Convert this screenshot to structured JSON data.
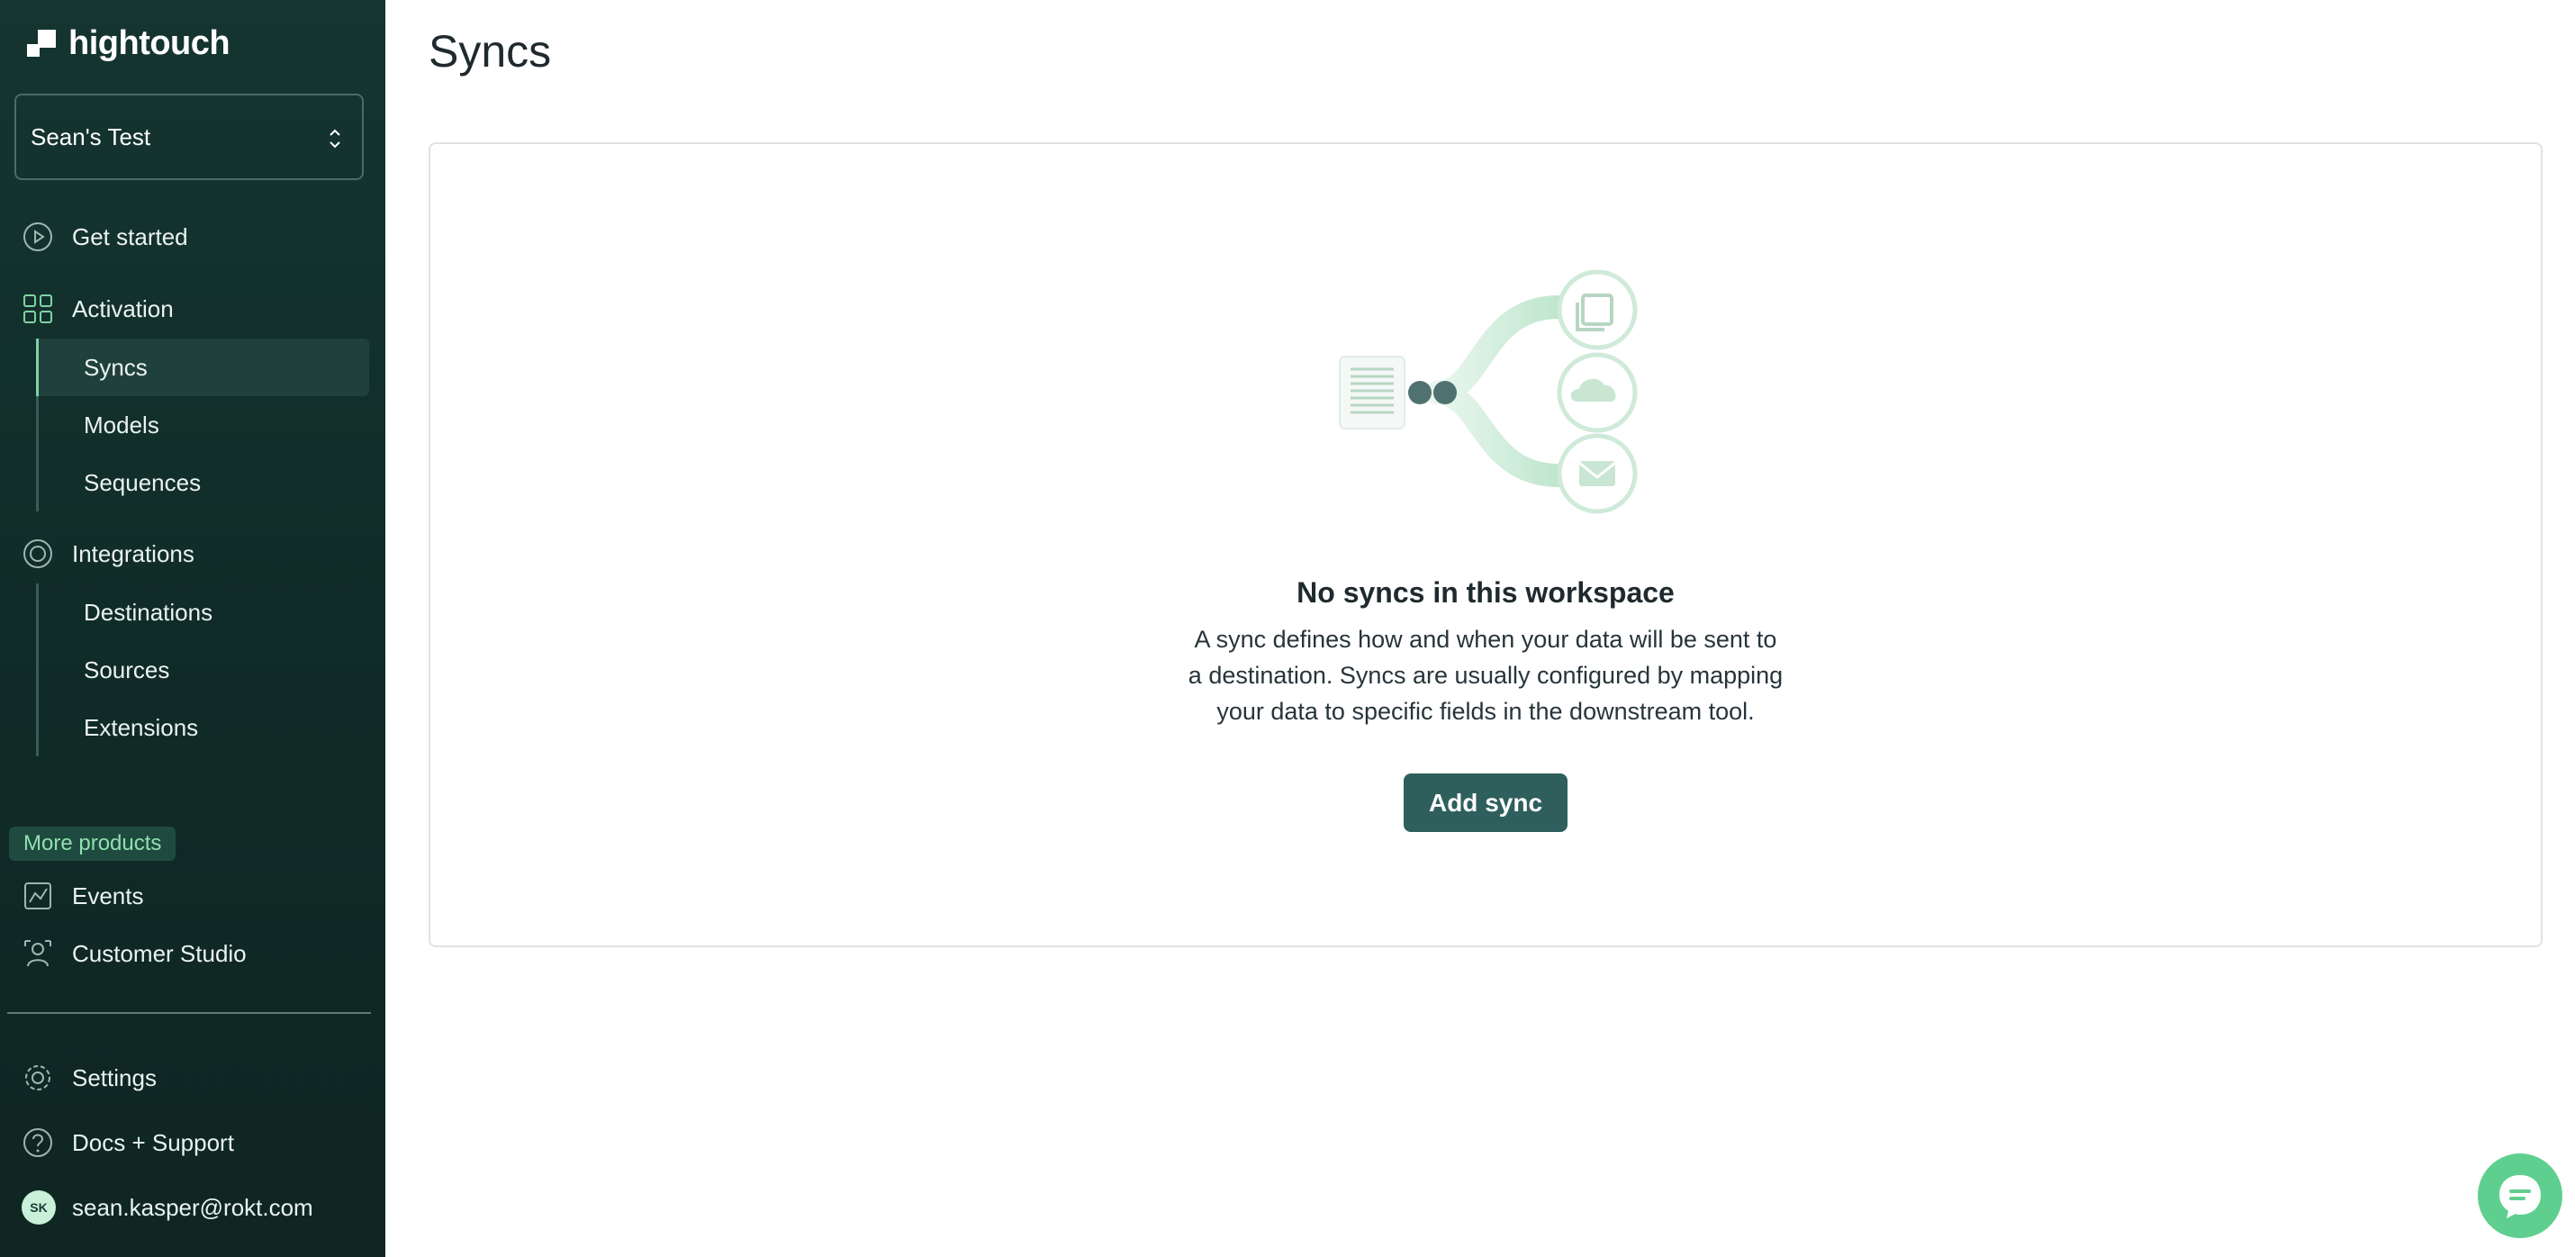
{
  "brand": {
    "name": "hightouch",
    "accent": "#7fd3a5",
    "sidebar_bg": "#153530",
    "button_bg": "#2e5f5c"
  },
  "workspace": {
    "name": "Sean's Test"
  },
  "sidebar": {
    "get_started": "Get started",
    "activation": {
      "label": "Activation",
      "items": [
        {
          "label": "Syncs",
          "active": true
        },
        {
          "label": "Models"
        },
        {
          "label": "Sequences"
        }
      ]
    },
    "integrations": {
      "label": "Integrations",
      "items": [
        {
          "label": "Destinations"
        },
        {
          "label": "Sources"
        },
        {
          "label": "Extensions"
        }
      ]
    },
    "more_products": "More products",
    "events": "Events",
    "customer_studio": "Customer Studio",
    "settings": "Settings",
    "docs_support": "Docs + Support",
    "user": {
      "initials": "SK",
      "email": "sean.kasper@rokt.com"
    }
  },
  "main": {
    "title": "Syncs",
    "empty_state": {
      "title": "No syncs in this workspace",
      "description_lines": [
        "A sync defines how and when your data will be sent to",
        "a destination. Syncs are usually configured by mapping",
        "your data to specific fields in the downstream tool."
      ],
      "button": "Add sync"
    }
  }
}
